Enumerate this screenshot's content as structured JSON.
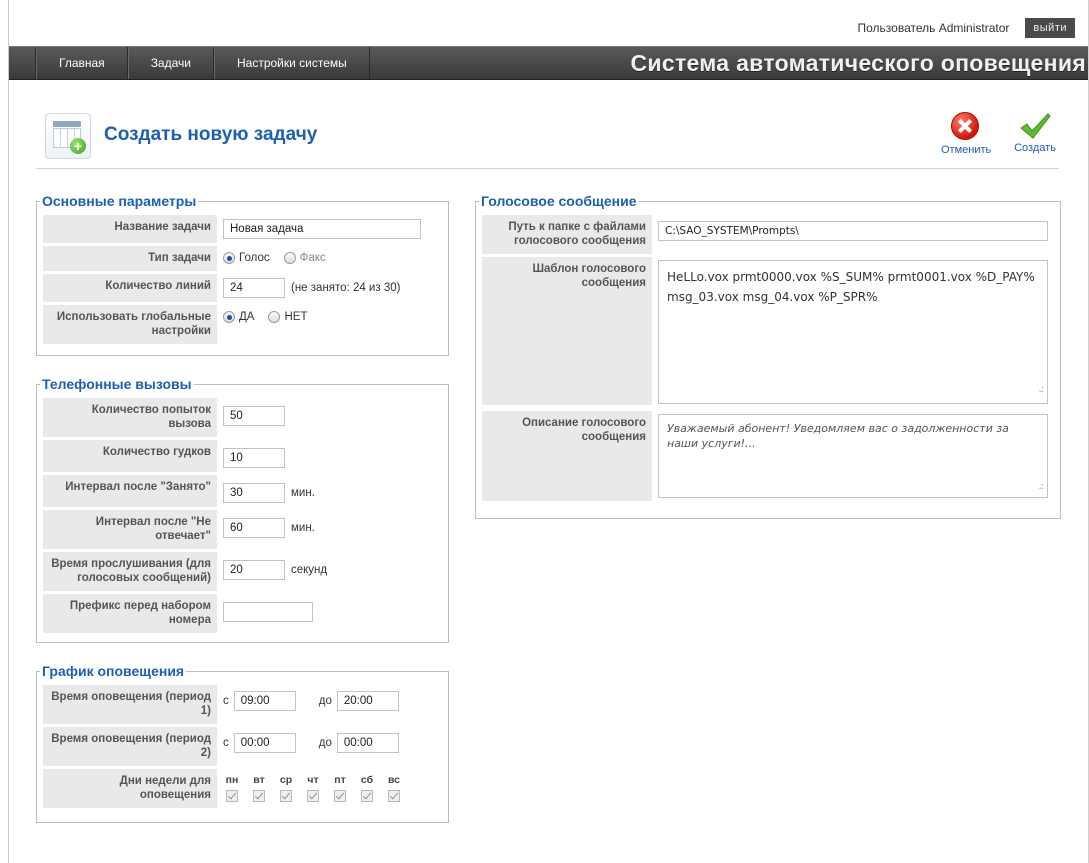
{
  "header": {
    "user_label": "Пользователь Administrator",
    "logout_label": "выйти"
  },
  "nav": {
    "items": [
      "Главная",
      "Задачи",
      "Настройки системы"
    ],
    "system_title": "Система автоматического оповещения"
  },
  "page": {
    "title": "Создать новую задачу",
    "cancel_label": "Отменить",
    "create_label": "Создать"
  },
  "basic": {
    "legend": "Основные параметры",
    "task_name_label": "Название задачи",
    "task_name_value": "Новая задача",
    "task_type_label": "Тип задачи",
    "type_voice": "Голос",
    "type_fax": "Факс",
    "lines_label": "Количество линий",
    "lines_value": "24",
    "lines_note": "(не занято: 24 из 30)",
    "global_label": "Использовать глобальные настройки",
    "global_yes": "ДА",
    "global_no": "НЕТ"
  },
  "calls": {
    "legend": "Телефонные вызовы",
    "attempts_label": "Количество попыток вызова",
    "attempts_value": "50",
    "rings_label": "Количество гудков",
    "rings_value": "10",
    "busy_label": "Интервал после \"Занято\"",
    "busy_value": "30",
    "busy_unit": "мин.",
    "noanswer_label": "Интервал после \"Не отвечает\"",
    "noanswer_value": "60",
    "noanswer_unit": "мин.",
    "listen_label": "Время прослушивания (для голосовых сообщений)",
    "listen_value": "20",
    "listen_unit": "секунд",
    "prefix_label": "Префикс перед набором номера",
    "prefix_value": ""
  },
  "schedule": {
    "legend": "График оповещения",
    "period1_label": "Время оповещения (период 1)",
    "period2_label": "Время оповещения (период 2)",
    "from_word": "с",
    "to_word": "до",
    "p1_from": "09:00",
    "p1_to": "20:00",
    "p2_from": "00:00",
    "p2_to": "00:00",
    "days_label": "Дни недели для оповещения",
    "days": [
      "пн",
      "вт",
      "ср",
      "чт",
      "пт",
      "сб",
      "вс"
    ]
  },
  "voice": {
    "legend": "Голосовое сообщение",
    "path_label": "Путь к папке с файлами голосового сообщения",
    "path_value": "C:\\SAO_SYSTEM\\Prompts\\",
    "template_label": "Шаблон голосового сообщения",
    "template_value": "HeLLo.vox prmt0000.vox %S_SUM% prmt0001.vox %D_PAY% msg_03.vox msg_04.vox %P_SPR%",
    "desc_label": "Описание голосового сообщения",
    "desc_value": "Уважаемый абонент! Уведомляем вас о задолженности за наши услуги!..."
  }
}
